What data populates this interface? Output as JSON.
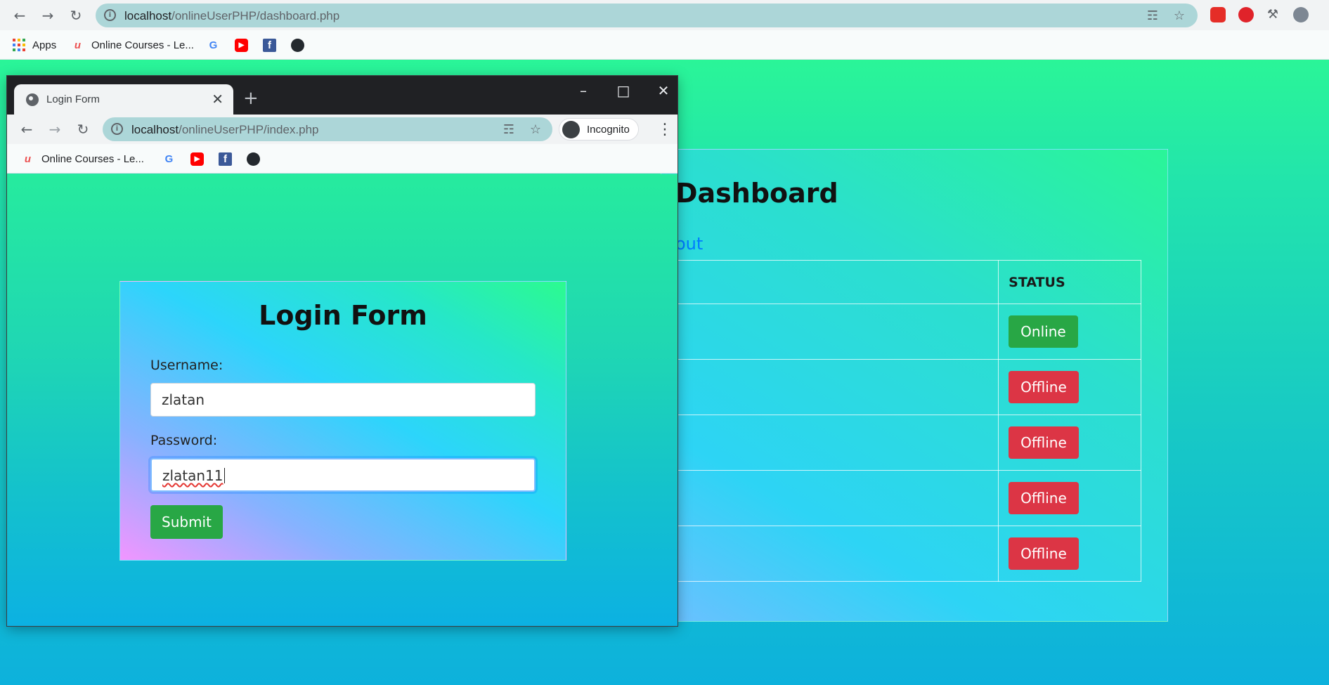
{
  "main_browser": {
    "url_host": "localhost",
    "url_path": "/onlineUserPHP/dashboard.php",
    "bookmarks": {
      "apps": "Apps",
      "online_courses": "Online Courses - Le..."
    }
  },
  "dashboard": {
    "title": "Dashboard",
    "logout_text": "out",
    "status_header": "STATUS",
    "rows": [
      {
        "status": "Online",
        "color": "#28a745"
      },
      {
        "status": "Offline",
        "color": "#dc3545"
      },
      {
        "status": "Offline",
        "color": "#dc3545"
      },
      {
        "status": "Offline",
        "color": "#dc3545"
      },
      {
        "status": "Offline",
        "color": "#dc3545"
      }
    ]
  },
  "incognito_window": {
    "tab_title": "Login Form",
    "url_host": "localhost",
    "url_path": "/onlineUserPHP/index.php",
    "incognito_label": "Incognito",
    "bookmarks": {
      "online_courses": "Online Courses - Le..."
    }
  },
  "login_form": {
    "title": "Login Form",
    "username_label": "Username:",
    "username_value": "zlatan",
    "password_label": "Password:",
    "password_value": "zlatan11",
    "submit_label": "Submit"
  },
  "colors": {
    "accent_green": "#28a745",
    "accent_red": "#dc3545",
    "link_blue": "#007bff"
  }
}
